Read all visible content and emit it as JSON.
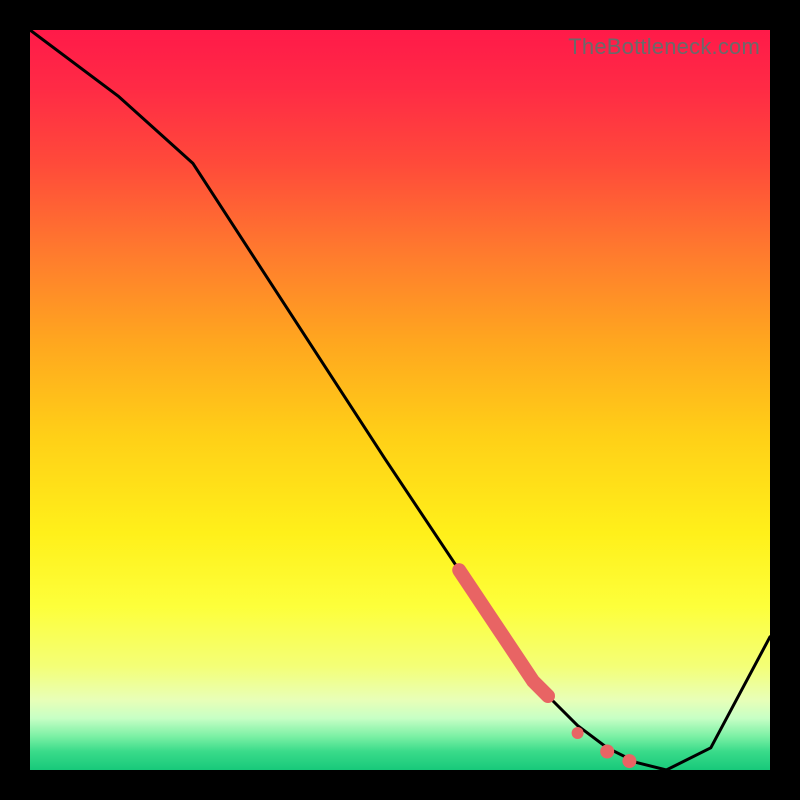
{
  "watermark": "TheBottleneck.com",
  "colors": {
    "frame_bg": "#000000",
    "curve": "#000000",
    "marker_fill": "#e86464",
    "marker_stroke": "#d94f4f"
  },
  "gradient_stops": [
    {
      "offset": 0.0,
      "color": "#ff1a49"
    },
    {
      "offset": 0.08,
      "color": "#ff2b45"
    },
    {
      "offset": 0.18,
      "color": "#ff4a3a"
    },
    {
      "offset": 0.3,
      "color": "#ff7a2e"
    },
    {
      "offset": 0.42,
      "color": "#ffa61f"
    },
    {
      "offset": 0.55,
      "color": "#ffd017"
    },
    {
      "offset": 0.68,
      "color": "#fff01a"
    },
    {
      "offset": 0.78,
      "color": "#fdff3b"
    },
    {
      "offset": 0.86,
      "color": "#f4ff77"
    },
    {
      "offset": 0.905,
      "color": "#e8ffb7"
    },
    {
      "offset": 0.93,
      "color": "#c7ffc5"
    },
    {
      "offset": 0.955,
      "color": "#7af0a4"
    },
    {
      "offset": 0.975,
      "color": "#3adb8a"
    },
    {
      "offset": 1.0,
      "color": "#17c97a"
    }
  ],
  "chart_data": {
    "type": "line",
    "title": "",
    "xlabel": "",
    "ylabel": "",
    "xlim": [
      0,
      100
    ],
    "ylim": [
      0,
      100
    ],
    "series": [
      {
        "name": "bottleneck-curve",
        "x": [
          0,
          12,
          22,
          35,
          48,
          58,
          62,
          66,
          70,
          74,
          78,
          82,
          86,
          92,
          100
        ],
        "y": [
          100,
          91,
          82,
          62,
          42,
          27,
          21,
          15,
          10,
          6,
          3,
          1,
          0,
          3,
          18
        ]
      }
    ],
    "markers": {
      "name": "highlight-segment",
      "points": [
        {
          "x": 58,
          "y": 27
        },
        {
          "x": 60,
          "y": 24
        },
        {
          "x": 62,
          "y": 21
        },
        {
          "x": 64,
          "y": 18
        },
        {
          "x": 66,
          "y": 15
        },
        {
          "x": 68,
          "y": 12
        },
        {
          "x": 70,
          "y": 10
        },
        {
          "x": 74,
          "y": 5
        },
        {
          "x": 78,
          "y": 2.5
        },
        {
          "x": 81,
          "y": 1.2
        }
      ]
    }
  }
}
